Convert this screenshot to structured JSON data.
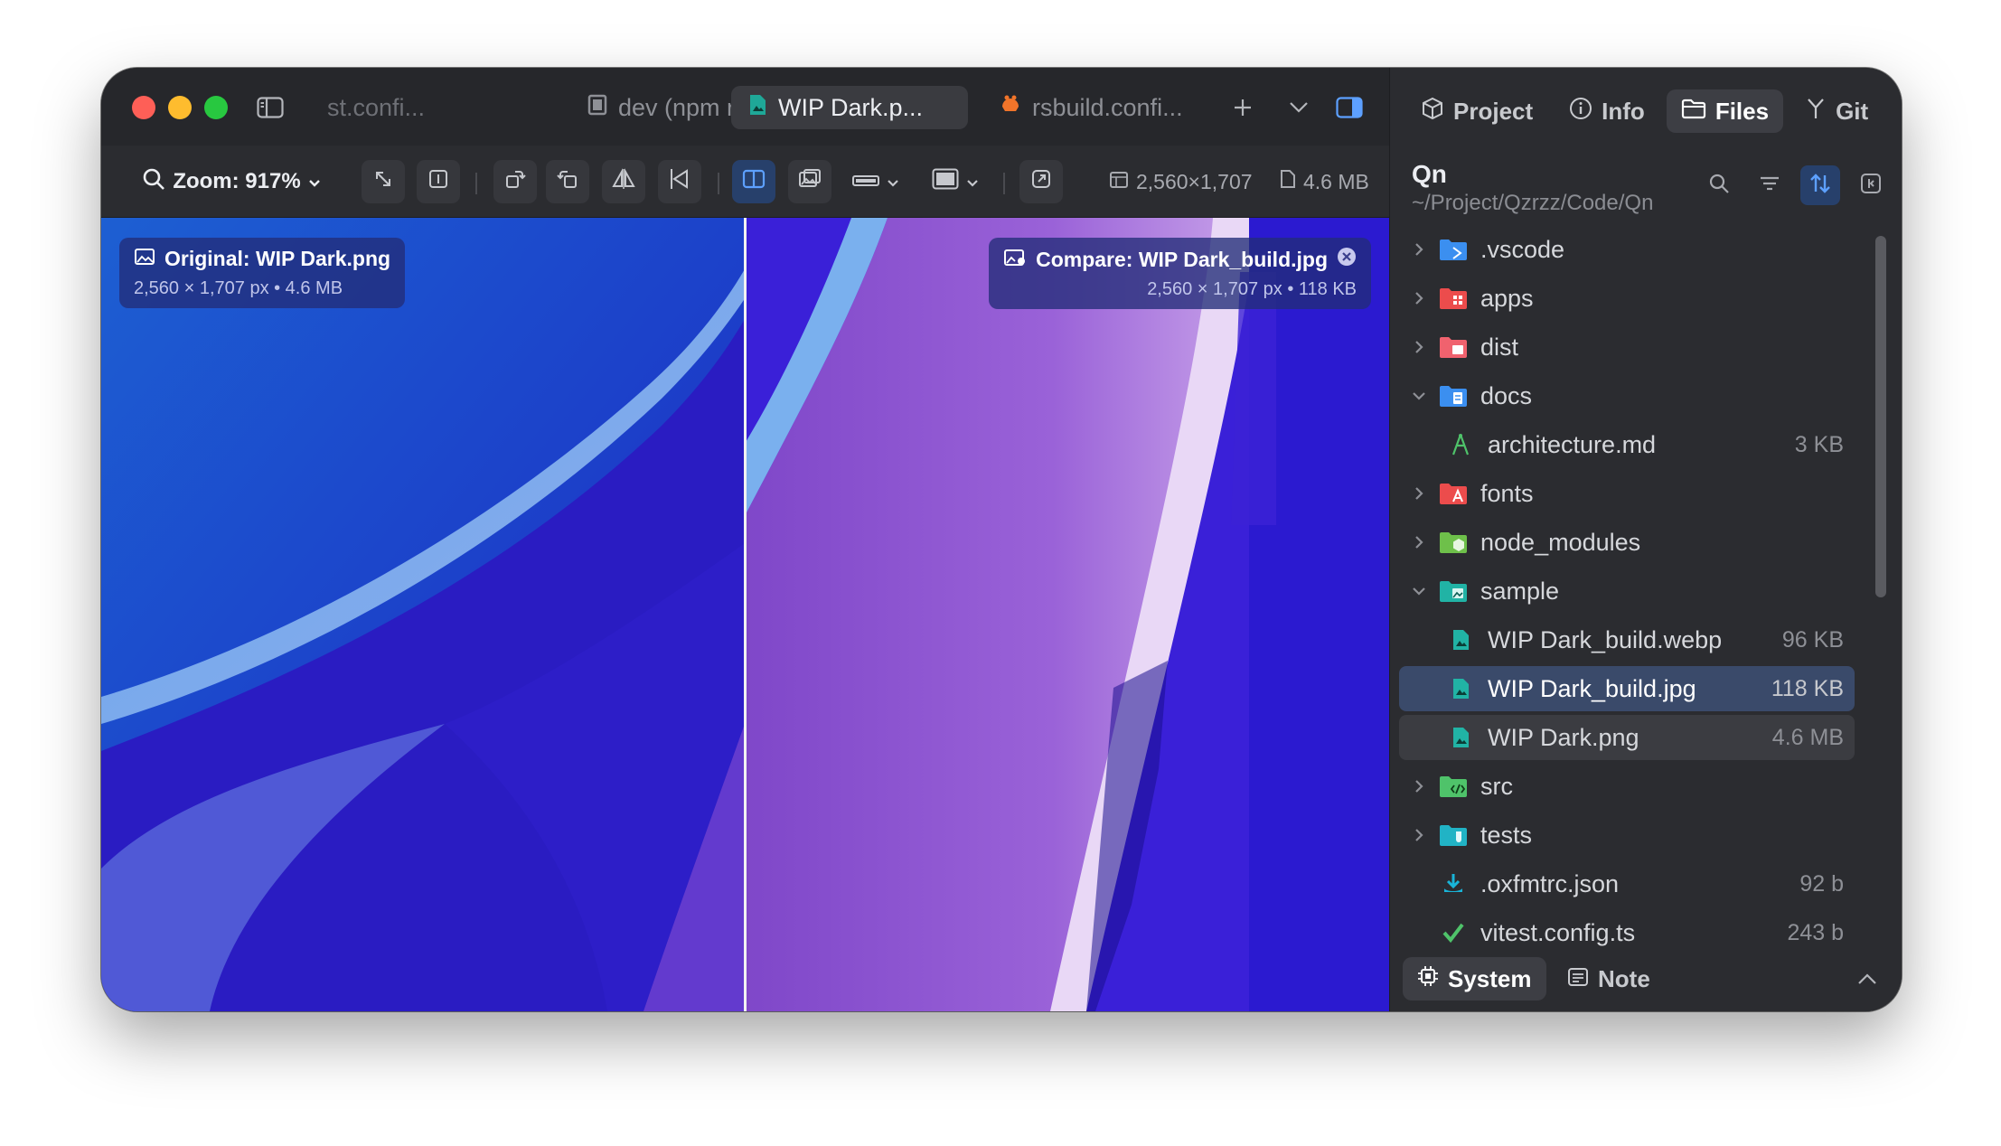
{
  "tabs": [
    {
      "label": "st.confi...",
      "icon": "config-file-icon"
    },
    {
      "label": "dev (npm ru...",
      "icon": "terminal-icon"
    },
    {
      "label": "WIP Dark.p...",
      "icon": "image-file-icon",
      "active": true
    },
    {
      "label": "rsbuild.confi...",
      "icon": "rsbuild-icon"
    }
  ],
  "toolbar": {
    "zoom_label": "Zoom: 917%",
    "dimensions": "2,560×1,707",
    "filesize": "4.6 MB"
  },
  "viewer": {
    "original_title": "Original: WIP Dark.png",
    "original_meta": "2,560 × 1,707 px  •  4.6 MB",
    "compare_title": "Compare: WIP Dark_build.jpg",
    "compare_meta": "2,560 × 1,707 px  •  118 KB"
  },
  "panel": {
    "tabs": [
      {
        "label": "Project",
        "icon": "cube-icon"
      },
      {
        "label": "Info",
        "icon": "info-icon"
      },
      {
        "label": "Files",
        "icon": "folder-icon",
        "active": true
      },
      {
        "label": "Git",
        "icon": "git-branch-icon"
      }
    ],
    "project_name": "Qn",
    "project_path": "~/Project/Qzrzz/Code/Qn"
  },
  "tree": [
    {
      "name": ".vscode",
      "type": "folder",
      "expanded": false,
      "color": "#3b8ff0",
      "level": 0
    },
    {
      "name": "apps",
      "type": "folder",
      "expanded": false,
      "color": "#ec4c4c",
      "level": 0
    },
    {
      "name": "dist",
      "type": "folder",
      "expanded": false,
      "color": "#f0626e",
      "level": 0
    },
    {
      "name": "docs",
      "type": "folder",
      "expanded": true,
      "color": "#3b8ff0",
      "level": 0
    },
    {
      "name": "architecture.md",
      "type": "file",
      "size": "3 KB",
      "color": "#4fc36a",
      "level": 1
    },
    {
      "name": "fonts",
      "type": "folder",
      "expanded": false,
      "color": "#ec4c4c",
      "level": 0
    },
    {
      "name": "node_modules",
      "type": "folder",
      "expanded": false,
      "color": "#6ec04a",
      "level": 0
    },
    {
      "name": "sample",
      "type": "folder",
      "expanded": true,
      "color": "#21b3a5",
      "level": 0
    },
    {
      "name": "WIP Dark_build.webp",
      "type": "file",
      "size": "96 KB",
      "color": "#21b3a5",
      "level": 1
    },
    {
      "name": "WIP Dark_build.jpg",
      "type": "file",
      "size": "118 KB",
      "color": "#21b3a5",
      "level": 1,
      "selected": true
    },
    {
      "name": "WIP Dark.png",
      "type": "file",
      "size": "4.6 MB",
      "color": "#21b3a5",
      "level": 1,
      "highlighted": true
    },
    {
      "name": "src",
      "type": "folder",
      "expanded": false,
      "color": "#4fc36a",
      "level": 0
    },
    {
      "name": "tests",
      "type": "folder",
      "expanded": false,
      "color": "#21b3c5",
      "level": 0
    },
    {
      "name": ".oxfmtrc.json",
      "type": "file",
      "size": "92 b",
      "color": "#19b4d8",
      "level": 0
    },
    {
      "name": "vitest.config.ts",
      "type": "file",
      "size": "243 b",
      "color": "#4fc36a",
      "level": 0
    }
  ],
  "bottom": {
    "system_label": "System",
    "note_label": "Note"
  }
}
